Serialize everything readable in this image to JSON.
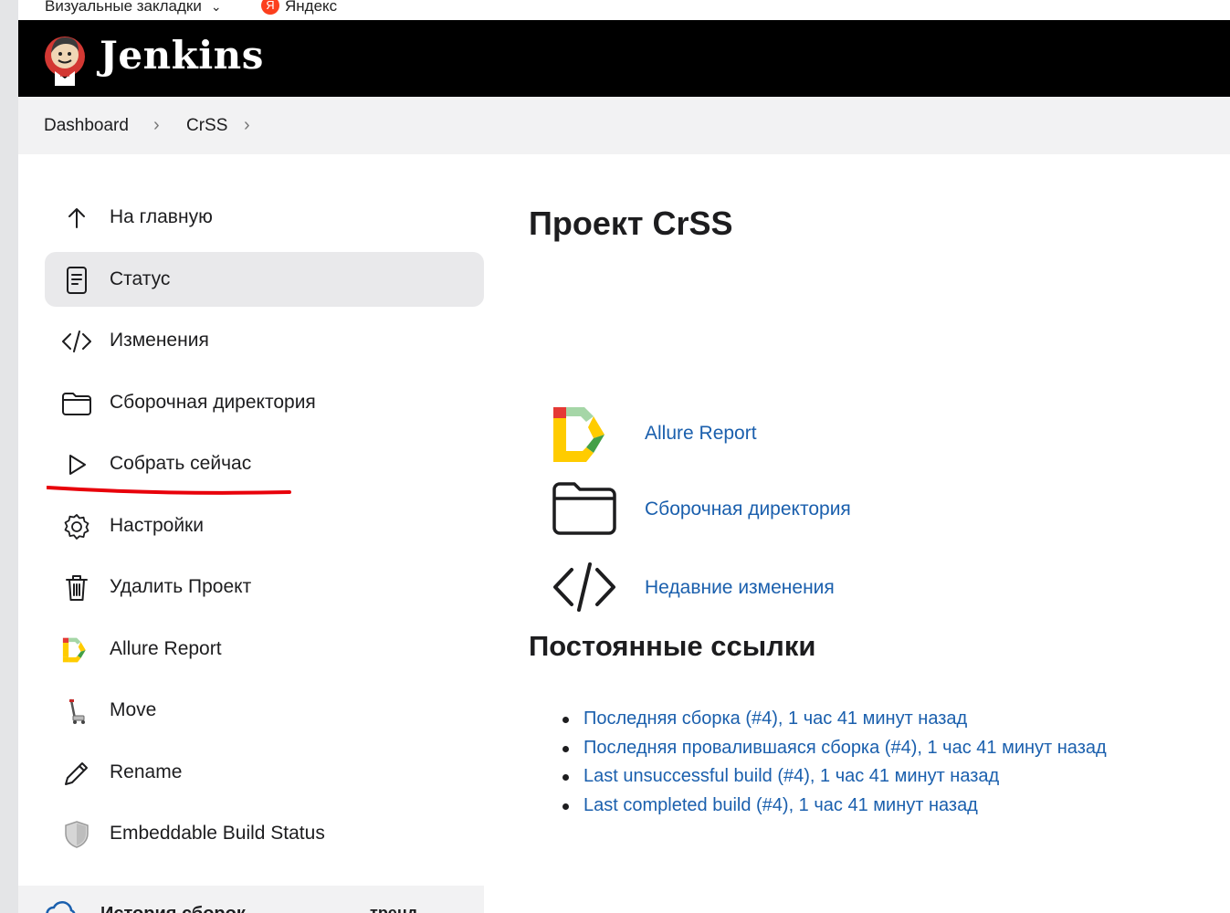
{
  "bookmarks_bar": {
    "items": [
      {
        "label": "Визуальные закладки"
      },
      {
        "label": "Яндекс",
        "icon": "yandex-icon"
      }
    ]
  },
  "header": {
    "brand": "Jenkins",
    "logo_icon": "jenkins-butler-logo"
  },
  "breadcrumb": {
    "items": [
      "Dashboard",
      "CrSS"
    ]
  },
  "sidebar": {
    "items": [
      {
        "label": "На главную",
        "icon": "arrow-up-icon"
      },
      {
        "label": "Статус",
        "icon": "document-icon",
        "active": true
      },
      {
        "label": "Изменения",
        "icon": "code-icon"
      },
      {
        "label": "Сборочная директория",
        "icon": "folder-icon"
      },
      {
        "label": "Собрать сейчас",
        "icon": "play-icon",
        "highlighted": true
      },
      {
        "label": "Настройки",
        "icon": "gear-icon"
      },
      {
        "label": "Удалить Проект",
        "icon": "trash-icon"
      },
      {
        "label": "Allure Report",
        "icon": "allure-icon"
      },
      {
        "label": "Move",
        "icon": "move-icon"
      },
      {
        "label": "Rename",
        "icon": "pencil-icon"
      },
      {
        "label": "Embeddable Build Status",
        "icon": "shield-icon"
      }
    ],
    "build_history": {
      "label": "История сборок",
      "trend_label": "тренд"
    }
  },
  "main": {
    "title": "Проект CrSS",
    "links": [
      {
        "label": "Allure Report",
        "icon": "allure-icon"
      },
      {
        "label": "Сборочная директория",
        "icon": "folder-icon"
      },
      {
        "label": "Недавние изменения",
        "icon": "code-icon"
      }
    ],
    "permalinks_title": "Постоянные ссылки",
    "permalinks": [
      "Последняя сборка (#4), 1 час 41 минут назад",
      "Последняя провалившаяся сборка (#4), 1 час 41 минут назад",
      "Last unsuccessful build (#4), 1 час 41 минут назад",
      "Last completed build (#4), 1 час 41 минут назад"
    ]
  },
  "colors": {
    "header_bg": "#000000",
    "link": "#1a5fad",
    "active_item_bg": "#e9e9eb",
    "annotation_red": "#e8000a"
  }
}
